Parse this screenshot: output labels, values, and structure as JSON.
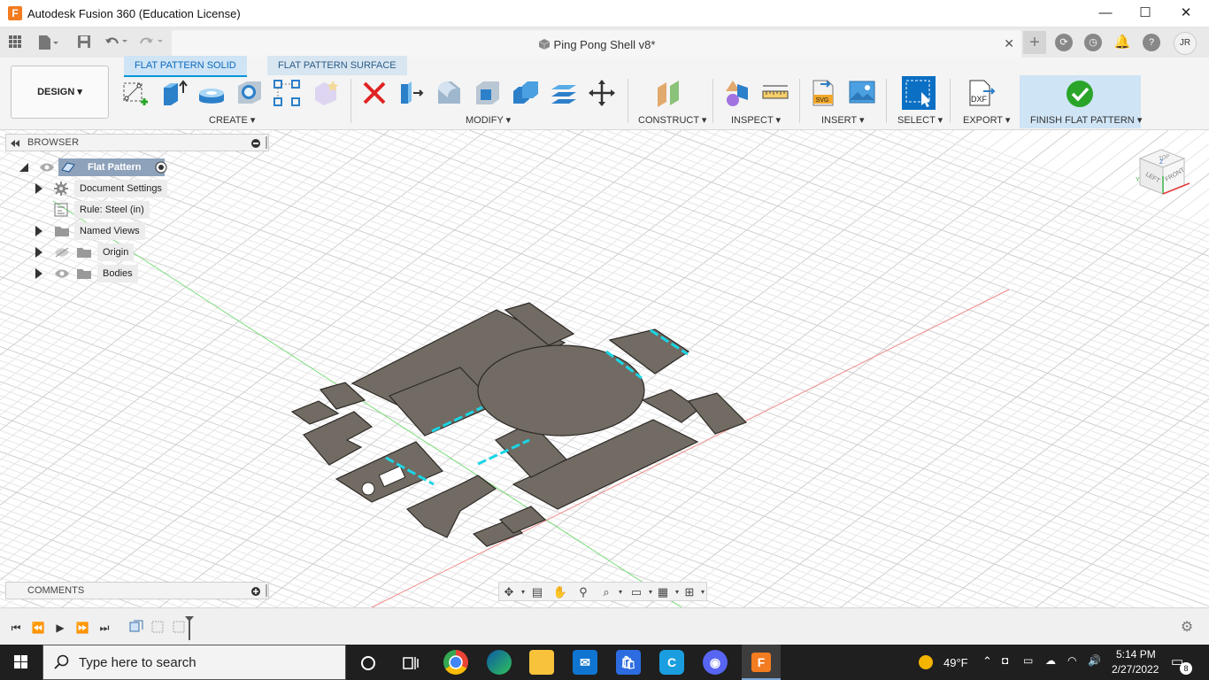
{
  "window": {
    "app_logo": "F",
    "title": "Autodesk Fusion 360 (Education License)",
    "min_glyph": "—",
    "max_glyph": "☐",
    "close_glyph": "✕"
  },
  "quickbar": {
    "document_title": "Ping Pong Shell v8*",
    "tab_close": "✕",
    "user_initials": "JR"
  },
  "ribbon": {
    "workspace": "DESIGN",
    "tabs": [
      "FLAT PATTERN SOLID",
      "FLAT PATTERN SURFACE"
    ],
    "groups": {
      "create": "CREATE",
      "modify": "MODIFY",
      "construct": "CONSTRUCT",
      "inspect": "INSPECT",
      "insert": "INSERT",
      "select": "SELECT",
      "export": "EXPORT",
      "finish": "FINISH FLAT PATTERN"
    },
    "export_dxf": "DXF",
    "insert_svg": "SVG"
  },
  "browser": {
    "title": "BROWSER",
    "items": [
      {
        "label": "Flat Pattern"
      },
      {
        "label": "Document Settings"
      },
      {
        "label": "Rule: Steel (in)"
      },
      {
        "label": "Named Views"
      },
      {
        "label": "Origin"
      },
      {
        "label": "Bodies"
      }
    ]
  },
  "comments": {
    "title": "COMMENTS"
  },
  "viewcube": {
    "top": "TOP",
    "left": "LEFT",
    "front": "FRONT",
    "axis_z": "Z",
    "axis_y": "Y"
  },
  "taskbar": {
    "search_placeholder": "Type here to search",
    "weather": "49°F",
    "time": "5:14 PM",
    "date": "2/27/2022",
    "notifications": "8"
  },
  "colors": {
    "accent": "#0696d7",
    "part_fill": "#716b63",
    "bend_line": "#19d6e6",
    "logo": "#f37b20"
  }
}
